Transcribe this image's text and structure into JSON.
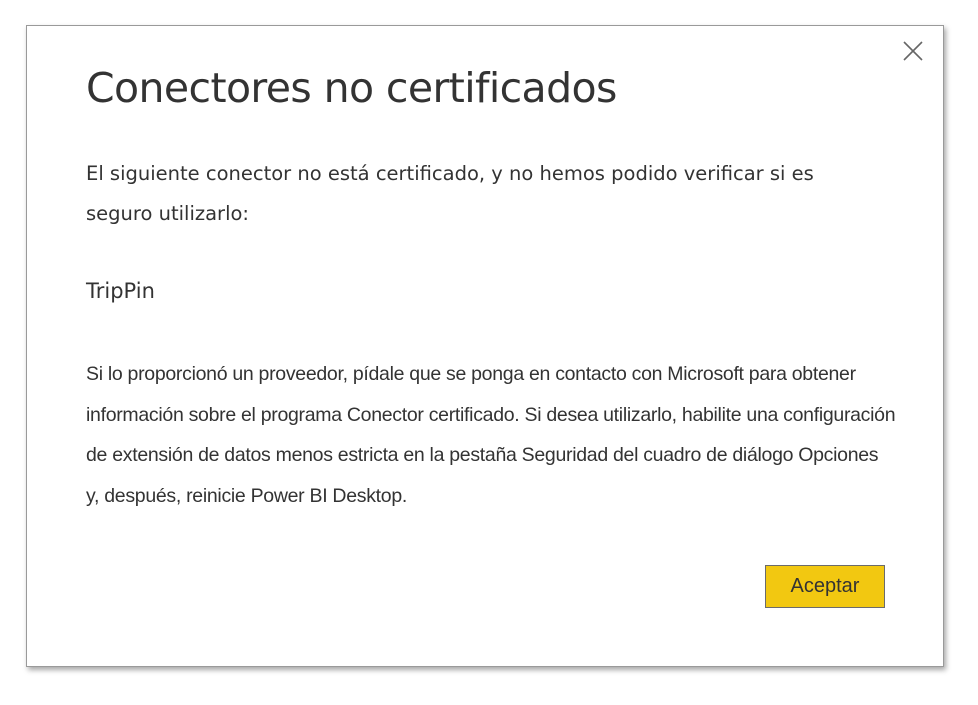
{
  "dialog": {
    "title": "Conectores no certificados",
    "intro": "El siguiente conector no está certificado, y no hemos podido verificar si es seguro utilizarlo:",
    "connector_name": "TripPin",
    "body": "Si lo proporcionó un proveedor, pídale que se ponga en contacto con Microsoft para obtener información sobre el programa Conector certificado. Si desea utilizarlo, habilite una configuración de extensión de datos menos estricta en la pestaña Seguridad del cuadro de diálogo Opciones y, después, reinicie Power BI Desktop.",
    "accept_label": "Aceptar",
    "close_icon": "close-icon"
  },
  "colors": {
    "accent": "#f2c811",
    "text": "#333333",
    "border": "#9a9a9a"
  }
}
